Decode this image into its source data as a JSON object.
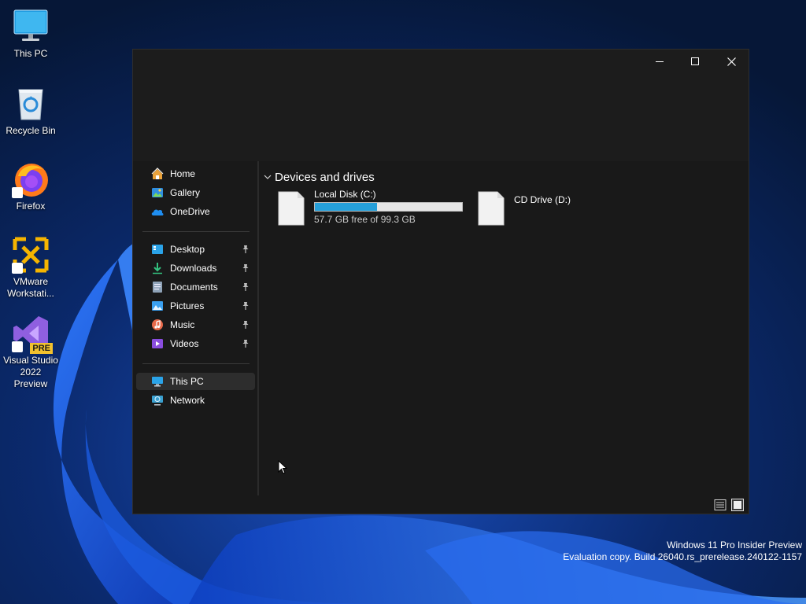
{
  "desktop": {
    "icons": [
      {
        "label": "This PC",
        "icon": "monitor-icon"
      },
      {
        "label": "Recycle Bin",
        "icon": "recycle-bin-icon"
      },
      {
        "label": "Firefox",
        "icon": "firefox-icon"
      },
      {
        "label": "VMware Workstati...",
        "icon": "vmware-icon"
      },
      {
        "label": "Visual Studio 2022 Preview",
        "icon": "visual-studio-icon",
        "badge": "PRE"
      }
    ]
  },
  "watermark": {
    "line1": "Windows 11 Pro Insider Preview",
    "line2": "Evaluation copy. Build 26040.rs_prerelease.240122-1157"
  },
  "explorer": {
    "caption_buttons": [
      "minimize",
      "maximize",
      "close"
    ],
    "nav": {
      "top": [
        {
          "label": "Home",
          "icon": "home-icon"
        },
        {
          "label": "Gallery",
          "icon": "gallery-icon"
        },
        {
          "label": "OneDrive",
          "icon": "onedrive-icon"
        }
      ],
      "quick_access": [
        {
          "label": "Desktop",
          "icon": "desktop-folder-icon",
          "pinned": true
        },
        {
          "label": "Downloads",
          "icon": "downloads-icon",
          "pinned": true
        },
        {
          "label": "Documents",
          "icon": "documents-icon",
          "pinned": true
        },
        {
          "label": "Pictures",
          "icon": "pictures-icon",
          "pinned": true
        },
        {
          "label": "Music",
          "icon": "music-icon",
          "pinned": true
        },
        {
          "label": "Videos",
          "icon": "videos-icon",
          "pinned": true
        }
      ],
      "locations": [
        {
          "label": "This PC",
          "icon": "this-pc-icon",
          "selected": true
        },
        {
          "label": "Network",
          "icon": "network-icon"
        }
      ]
    },
    "content": {
      "group_title": "Devices and drives",
      "drives": [
        {
          "name": "Local Disk (C:)",
          "free_text": "57.7 GB free of 99.3 GB",
          "used_fraction": 0.42
        },
        {
          "name": "CD Drive (D:)"
        }
      ]
    },
    "colors": {
      "accent": "#26a0da",
      "window_bg": "#191919"
    }
  }
}
